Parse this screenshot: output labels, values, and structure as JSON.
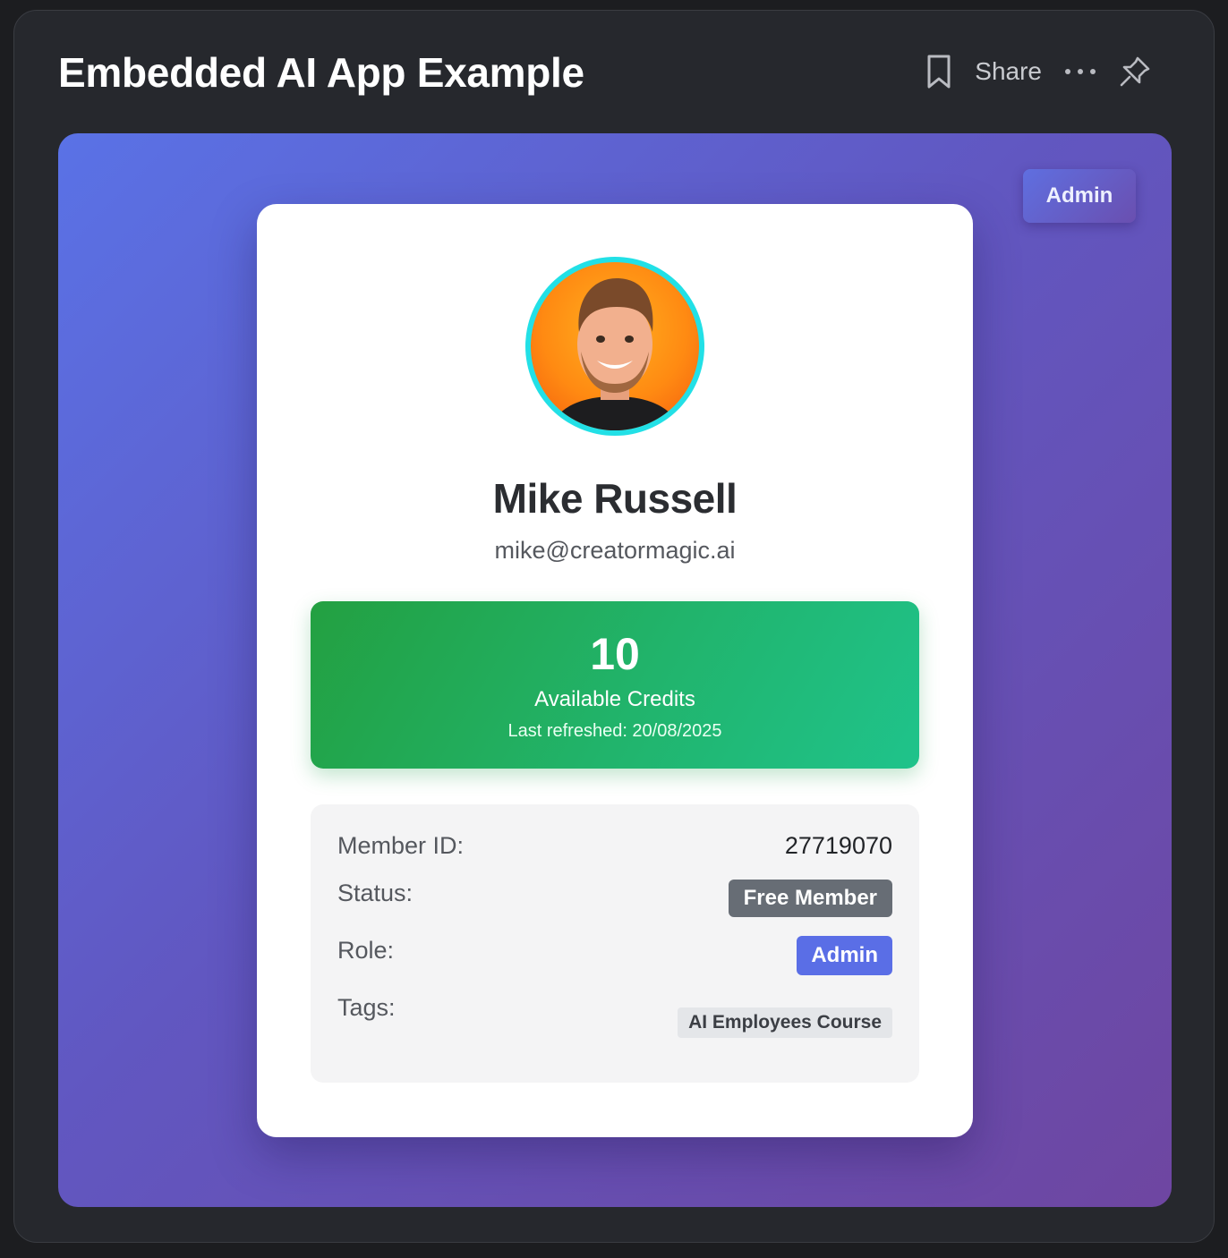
{
  "header": {
    "title": "Embedded AI App Example",
    "share_label": "Share",
    "icons": [
      "bookmark-icon",
      "more-icon",
      "pin-icon"
    ]
  },
  "app": {
    "admin_button_label": "Admin",
    "profile": {
      "name": "Mike Russell",
      "email": "mike@creatormagic.ai"
    },
    "credits": {
      "value": "10",
      "label": "Available Credits",
      "refreshed": "Last refreshed: 20/08/2025"
    },
    "info": {
      "member_id_label": "Member ID:",
      "member_id_value": "27719070",
      "status_label": "Status:",
      "status_value": "Free Member",
      "role_label": "Role:",
      "role_value": "Admin",
      "tags_label": "Tags:",
      "tags": [
        "AI Employees Course"
      ]
    }
  },
  "colors": {
    "window_bg": "#26282d",
    "gradient_start": "#5a72e6",
    "gradient_end": "#6e46a1",
    "credits_green": "#23a041",
    "credits_teal": "#1fc38b",
    "status_badge": "#676d75",
    "role_badge": "#5a6ee6",
    "avatar_ring": "#22e0e6"
  }
}
